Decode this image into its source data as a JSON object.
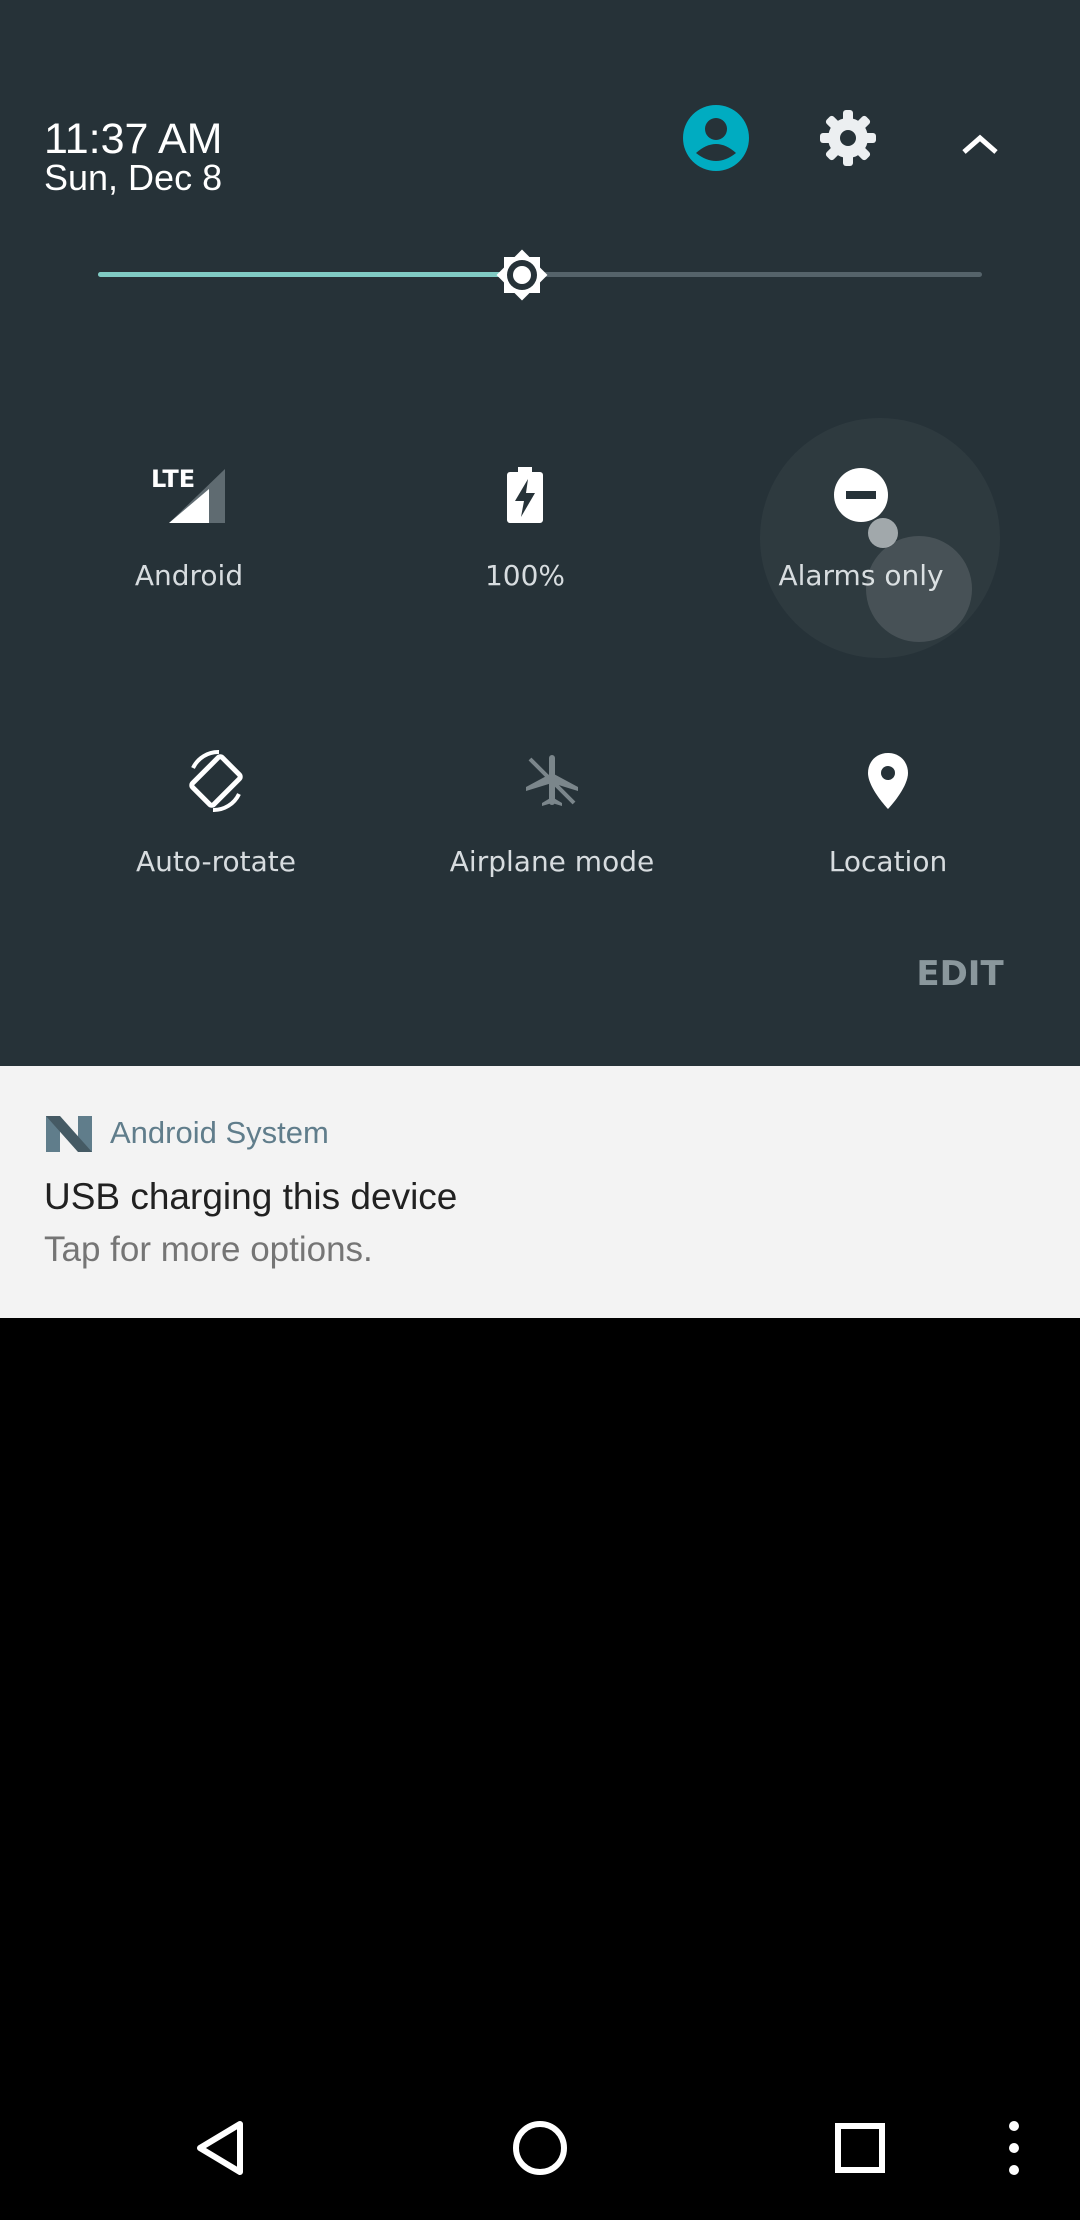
{
  "header": {
    "time": "11:37 AM",
    "date": "Sun, Dec 8",
    "avatar_icon": "account-circle-icon",
    "settings_icon": "gear-icon",
    "collapse_icon": "chevron-up-icon"
  },
  "brightness": {
    "icon": "brightness-icon",
    "level": 0.48,
    "accent_color": "#80cbc4"
  },
  "tiles": [
    {
      "label": "Android",
      "icon": "lte-signal-icon",
      "active": true
    },
    {
      "label": "100%",
      "icon": "battery-charging-icon",
      "active": true
    },
    {
      "label": "Alarms only",
      "icon": "do-not-disturb-icon",
      "active": true
    },
    {
      "label": "Auto-rotate",
      "icon": "auto-rotate-icon",
      "active": true
    },
    {
      "label": "Airplane mode",
      "icon": "airplane-icon",
      "active": false
    },
    {
      "label": "Location",
      "icon": "location-pin-icon",
      "active": true
    }
  ],
  "edit_label": "EDIT",
  "notification": {
    "app_icon": "android-n-icon",
    "app_name": "Android System",
    "title": "USB charging this device",
    "text": "Tap for more options."
  },
  "navbar": {
    "back_icon": "back-triangle-icon",
    "home_icon": "home-circle-icon",
    "recents_icon": "recents-square-icon",
    "menu_icon": "overflow-menu-icon"
  },
  "colors": {
    "panel_bg": "#263238",
    "avatar": "#00acc1",
    "notification_bg": "#f3f3f3",
    "app_name": "#607d8b"
  }
}
